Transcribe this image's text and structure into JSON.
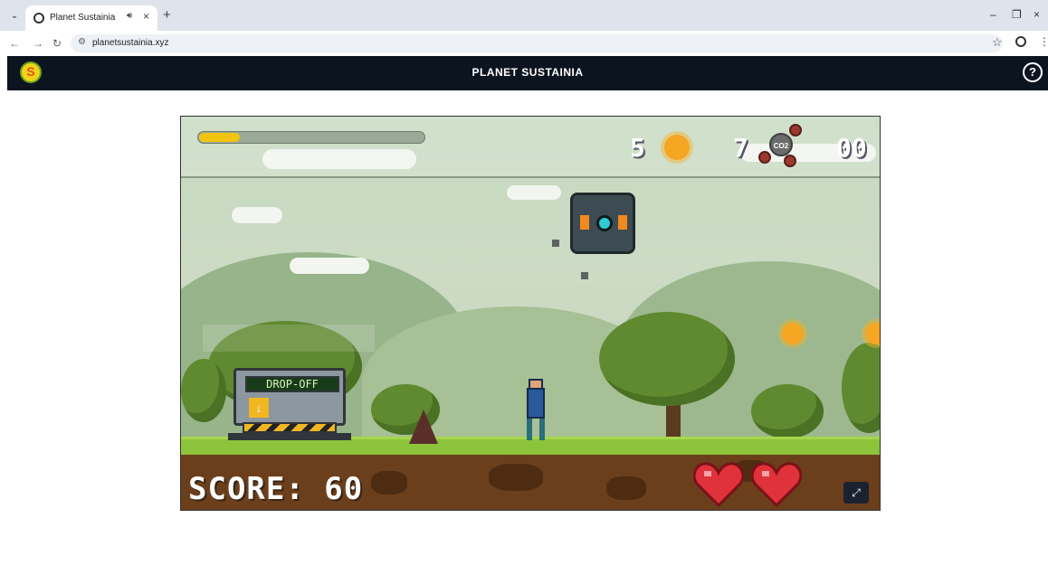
{
  "browser": {
    "tab_title": "Planet Sustainia",
    "url": "planetsustainia.xyz",
    "icons": [
      "tab-dropdown-icon",
      "audio-icon",
      "close-icon",
      "new-tab-icon",
      "back-icon",
      "forward-icon",
      "reload-icon",
      "site-info-icon",
      "star-icon",
      "profile-icon",
      "menu-icon",
      "minimize-icon",
      "restore-icon"
    ]
  },
  "header": {
    "title": "PLANET SUSTAINIA",
    "help_label": "?"
  },
  "game": {
    "progress_fraction": 0.18,
    "sun_count": "5",
    "co2_count": "7",
    "co2_label": "CO2",
    "timer": "00",
    "dropoff_label": "DROP-OFF",
    "score_text": "SCORE: 60",
    "lives": 2,
    "colors": {
      "progress": "#f1c40f",
      "heart": "#e0323a",
      "header_bg": "#0c1420"
    }
  }
}
